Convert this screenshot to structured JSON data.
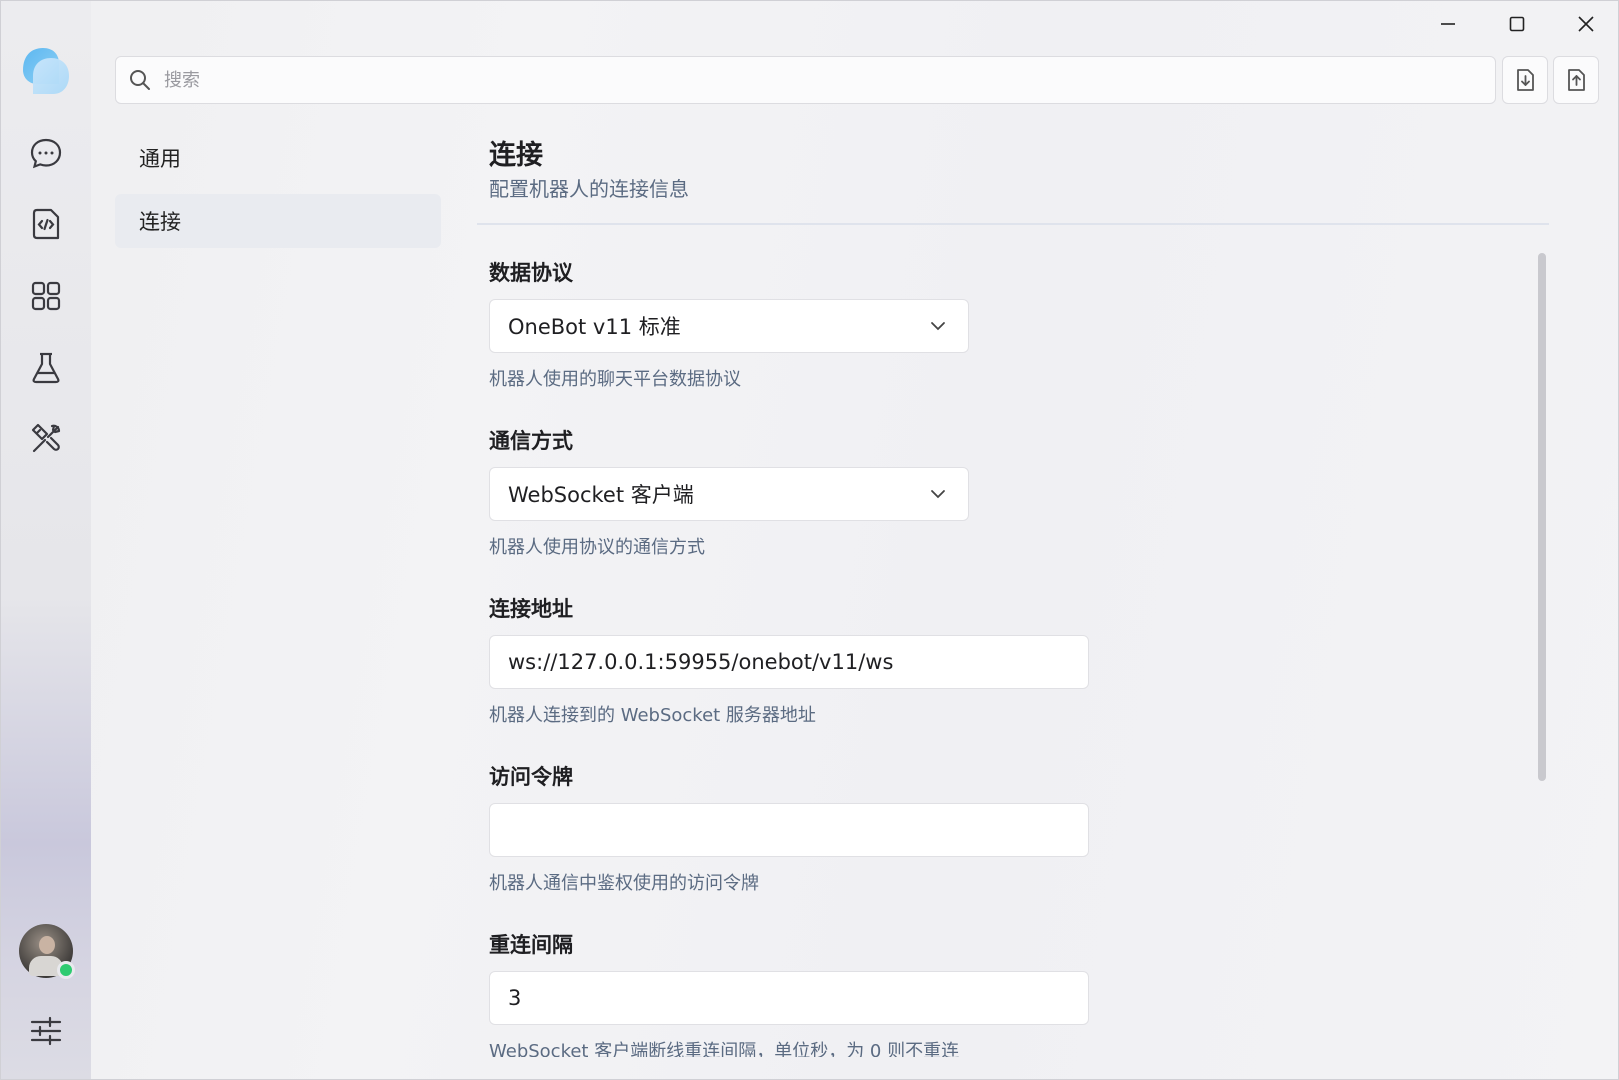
{
  "search": {
    "placeholder": "搜索"
  },
  "nav": {
    "items": [
      {
        "label": "通用"
      },
      {
        "label": "连接"
      }
    ]
  },
  "section": {
    "title": "连接",
    "subtitle": "配置机器人的连接信息"
  },
  "fields": {
    "protocol": {
      "label": "数据协议",
      "value": "OneBot v11 标准",
      "hint": "机器人使用的聊天平台数据协议"
    },
    "method": {
      "label": "通信方式",
      "value": "WebSocket 客户端",
      "hint": "机器人使用协议的通信方式"
    },
    "address": {
      "label": "连接地址",
      "value": "ws://127.0.0.1:59955/onebot/v11/ws",
      "hint": "机器人连接到的 WebSocket 服务器地址"
    },
    "token": {
      "label": "访问令牌",
      "value": "",
      "hint": "机器人通信中鉴权使用的访问令牌"
    },
    "reconnect": {
      "label": "重连间隔",
      "value": "3",
      "hint": "WebSocket 客户端断线重连间隔，单位秒，为 0 则不重连"
    }
  },
  "colors": {
    "accent": "#5aa8e8",
    "online": "#2ecb71",
    "muted_text": "#5b6b82"
  },
  "icons": {
    "activity": [
      "chat-icon",
      "code-file-icon",
      "apps-grid-icon",
      "flask-icon",
      "tools-icon"
    ],
    "settings": "sliders-icon",
    "window": [
      "minimize-icon",
      "maximize-icon",
      "close-icon"
    ],
    "toolbar": [
      "import-icon",
      "export-icon"
    ]
  }
}
